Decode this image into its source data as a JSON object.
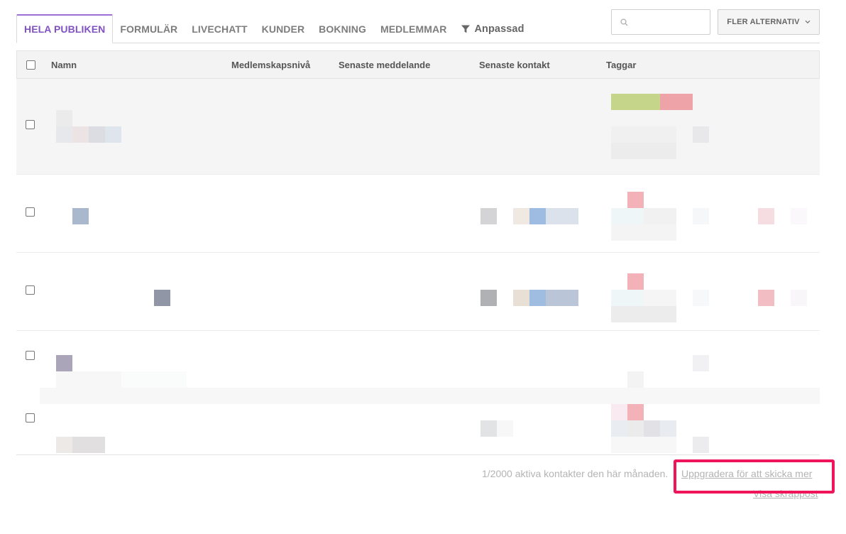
{
  "tabs": [
    {
      "label": "HELA PUBLIKEN",
      "active": true
    },
    {
      "label": "FORMULÄR"
    },
    {
      "label": "LIVECHATT"
    },
    {
      "label": "KUNDER"
    },
    {
      "label": "BOKNING"
    },
    {
      "label": "MEDLEMMAR"
    },
    {
      "label": "Anpassad",
      "icon": "filter-icon"
    }
  ],
  "search": {
    "placeholder": "",
    "value": "",
    "icon": "search-icon"
  },
  "more_options": {
    "label": "FLER ALTERNATIV",
    "icon": "chevron-down-icon"
  },
  "table": {
    "columns": [
      "Namn",
      "Medlemskapsnivå",
      "Senaste meddelande",
      "Senaste kontakt",
      "Taggar"
    ],
    "rows": [
      {
        "name": "",
        "membership": "",
        "last_message": "",
        "last_contact": "",
        "tags": "",
        "redacted": true
      },
      {
        "name": "",
        "membership": "",
        "last_message": "",
        "last_contact": "",
        "tags": "",
        "redacted": true
      },
      {
        "name": "",
        "membership": "",
        "last_message": "",
        "last_contact": "",
        "tags": "",
        "redacted": true
      },
      {
        "name": "",
        "membership": "",
        "last_message": "",
        "last_contact": "",
        "tags": "",
        "redacted": true
      },
      {
        "name": "",
        "membership": "",
        "last_message": "",
        "last_contact": "",
        "tags": "",
        "redacted": true
      }
    ]
  },
  "footer": {
    "active_contacts": "1/2000 aktiva kontakter den här månaden.",
    "upgrade_link": "Uppgradera för att skicka mer",
    "spam_link": "Visa skräppost"
  },
  "colors": {
    "accent": "#8152c2",
    "highlight": "#f0145a",
    "tag_green": "#c5d68a",
    "tag_red": "#eda3a8"
  }
}
